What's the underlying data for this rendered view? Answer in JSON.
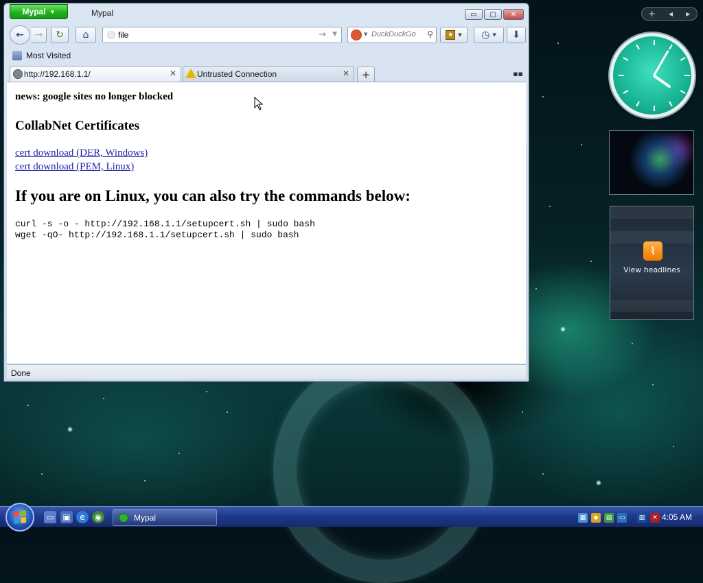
{
  "window": {
    "app_button_label": "Mypal",
    "title": "Mypal",
    "controls": {
      "minimize": "▭",
      "maximize": "▢",
      "close": "✕"
    }
  },
  "navbar": {
    "url_value": "file",
    "search_placeholder": "DuckDuckGo"
  },
  "bookmarks_bar": {
    "most_visited": "Most Visited"
  },
  "tabs": [
    {
      "label": "http://192.168.1.1/",
      "icon": "globe-icon",
      "active": true
    },
    {
      "label": "Untrusted Connection",
      "icon": "warning-icon",
      "active": false
    }
  ],
  "page": {
    "news": "news: google sites no longer blocked",
    "cert_heading": "CollabNet Certificates",
    "links": [
      "cert download (DER, Windows)",
      "cert download (PEM, Linux)"
    ],
    "linux_heading": "If you are on Linux, you can also try the commands below:",
    "commands": [
      "curl -s -o - http://192.168.1.1/setupcert.sh | sudo bash",
      "wget -qO- http://192.168.1.1/setupcert.sh | sudo bash"
    ]
  },
  "status": {
    "text": "Done"
  },
  "gadgets": {
    "feed_label": "View headlines"
  },
  "taskbar": {
    "task_label": "Mypal",
    "time": "4:05 AM"
  },
  "colors": {
    "app_button": "#21b21e",
    "link": "#2020a8",
    "clock_face": "#17b493",
    "taskbar": "#1e3a8e"
  }
}
